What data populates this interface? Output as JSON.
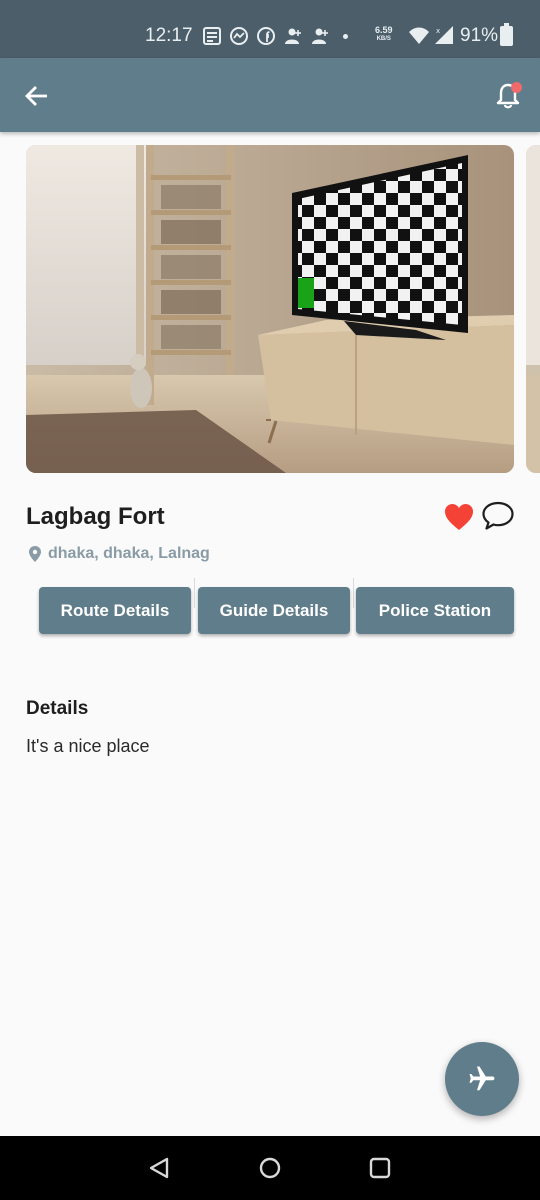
{
  "status_bar": {
    "time": "12:17",
    "net_speed_value": "6.59",
    "net_speed_unit": "KB/S",
    "battery": "91%",
    "icons": [
      "notes-icon",
      "messenger-icon",
      "facebook-icon",
      "person-add-icon",
      "person-add-icon",
      "dot-icon",
      "wifi-icon",
      "signal-icon",
      "battery-icon"
    ]
  },
  "app_bar": {
    "back_icon": "arrow-left-icon",
    "notification_icon": "bell-icon",
    "notification_badge_color": "#ef6b6b"
  },
  "place": {
    "title": "Lagbag Fort",
    "location": "dhaka, dhaka, Lalnag",
    "liked": true
  },
  "buttons": {
    "route": "Route Details",
    "guide": "Guide Details",
    "police": "Police Station"
  },
  "details": {
    "heading": "Details",
    "text": "It's a nice place"
  },
  "fab": {
    "icon": "airplane-icon"
  },
  "colors": {
    "primary": "#607d8b",
    "status_bar": "#4b5e6a",
    "heart": "#f44336",
    "location_text": "#8a9ba6"
  }
}
